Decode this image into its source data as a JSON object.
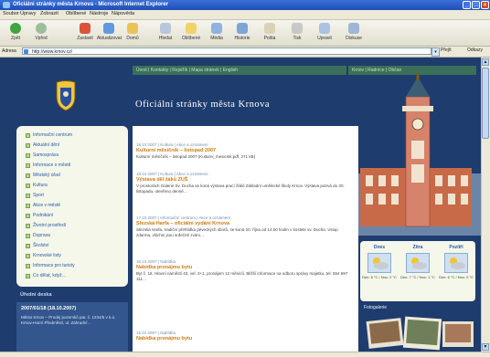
{
  "window": {
    "title": "Oficiální stránky města Krnova - Microsoft Internet Explorer",
    "controls": {
      "minimize": "_",
      "maximize": "□",
      "close": "×"
    }
  },
  "menubar": {
    "items": [
      "Soubor",
      "Úpravy",
      "Zobrazit",
      "Oblíbené",
      "Nástroje",
      "Nápověda"
    ]
  },
  "toolbar": {
    "back": "Zpět",
    "forward": "Vpřed",
    "stop": "Zastavit",
    "refresh": "Aktualizovat",
    "home": "Domů",
    "search": "Hledat",
    "favorites": "Oblíbené",
    "media": "Média",
    "history": "Historie",
    "mail": "Pošta",
    "print": "Tisk",
    "edit": "Upravit",
    "discuss": "Diskuse"
  },
  "addressbar": {
    "label": "Adresa",
    "url": "http://www.krnov.cz/",
    "go": "Přejít",
    "links": "Odkazy"
  },
  "page": {
    "title": "Oficiální stránky města Krnova",
    "topnav": "Úvod | Kontakty | Rejstřík | Mapa stránek | English",
    "topnav_right": "Krnov | Radnice | Občan",
    "sidebar": {
      "items": [
        "Informační centrum",
        "Aktuální dění",
        "Samospráva",
        "Informace o městě",
        "Městský úřad",
        "Kultura",
        "Sport",
        "Akce v městě",
        "Podnikání",
        "Životní prostředí",
        "Doprava",
        "Školství",
        "Krnovské listy",
        "Informace pro turisty",
        "Co dělat, když…"
      ],
      "notice_title": "Úřední deska",
      "notice_head": "2007/01/18 (18.10.2007)",
      "notice_body": "Město Krnov – Prodej pozemků par. č. 1234/5 v k.ú. Krnov-Horní Předměstí, ul. Zahradní…"
    },
    "news": [
      {
        "date": "18.10.2007 | Kultura | Akce a oznámení",
        "title": "Kulturní měsíčník – listopad 2007",
        "text": "Kulturní měsíčník – listopad 2007 (Kulturni_mesicnik.pdf, 271 kB)"
      },
      {
        "date": "18.10.2007 | Kultura | Akce a oznámení",
        "title": "Výstava děl žáků ZUŠ",
        "text": "V prostorách Galerie Sv. Ducha se koná výstava prací žáků Základní umělecké školy Krnov. Výstava potrvá do 30. listopadu, otevřeno denně…"
      },
      {
        "date": "17.10.2007 | Informační centrum | Akce a oznámení",
        "title": "Slezská Harfa – oficiální vydání Krnova",
        "text": "Slezská Harfa, tradiční přehlídka pěveckých sborů, se koná 20. října od 14.00 hodin v kostele sv. Ducha. Vstup zdarma, všichni jsou srdečně zváni…"
      },
      {
        "date": "16.10.2007 | Nabídka",
        "title": "Nabídka pronájmu bytu",
        "text": "Byt č. 16, Hlavní náměstí 43, vel. 2+1, pronájem 12 měsíců. Bližší informace na odboru správy majetku, tel. 554 697 111…"
      },
      {
        "date": "15.10.2007 | Nabídka",
        "title": "Nabídka pronájmu bytu",
        "text": ""
      }
    ],
    "weather": {
      "days": [
        {
          "name": "Dnes",
          "temp": "Den: 8 °C / Noc: 2 °C"
        },
        {
          "name": "Zítra",
          "temp": "Den: 7 °C / Noc: 1 °C"
        },
        {
          "name": "Pozítří",
          "temp": "Den: 6 °C / Noc: 0 °C"
        }
      ]
    },
    "photo_title": "Fotogalerie"
  },
  "colors": {
    "page_bg": "#1e3c6e",
    "link": "#2a5aa8",
    "news_title": "#d07a10",
    "nav_green": "#3b6f5a"
  }
}
